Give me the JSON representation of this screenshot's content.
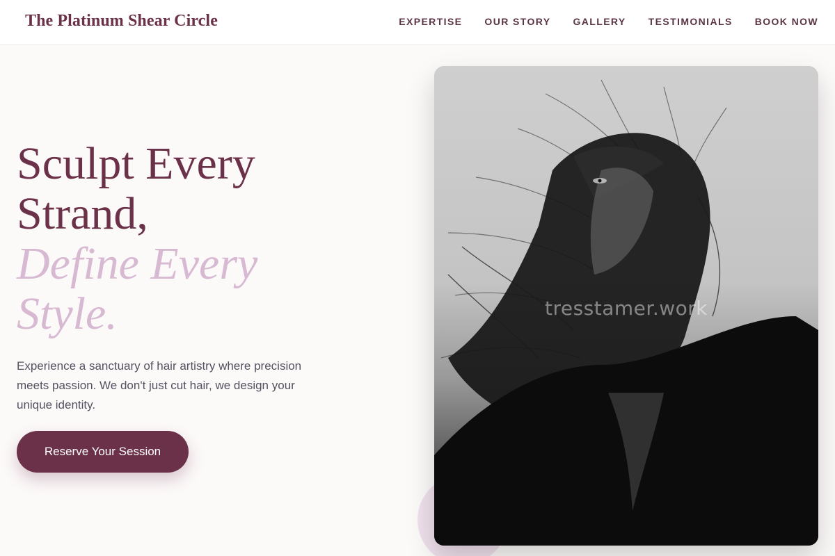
{
  "brand": {
    "name": "The Platinum Shear Circle"
  },
  "nav": {
    "items": [
      {
        "label": "EXPERTISE"
      },
      {
        "label": "OUR STORY"
      },
      {
        "label": "GALLERY"
      },
      {
        "label": "TESTIMONIALS"
      },
      {
        "label": "BOOK NOW"
      }
    ]
  },
  "hero": {
    "title_line1": "Sculpt Every",
    "title_line2": "Strand,",
    "title_line3": "Define Every",
    "title_line4": "Style.",
    "description": "Experience a sanctuary of hair artistry where precision meets passion. We don't just cut hair, we design your unique identity.",
    "cta_label": "Reserve Your Session",
    "image_watermark": "tresstamer.work"
  },
  "colors": {
    "brand": "#6b3148",
    "accent_lilac": "#d7b9d2",
    "background": "#fcf9f9",
    "text_muted": "#545160"
  },
  "icons": []
}
